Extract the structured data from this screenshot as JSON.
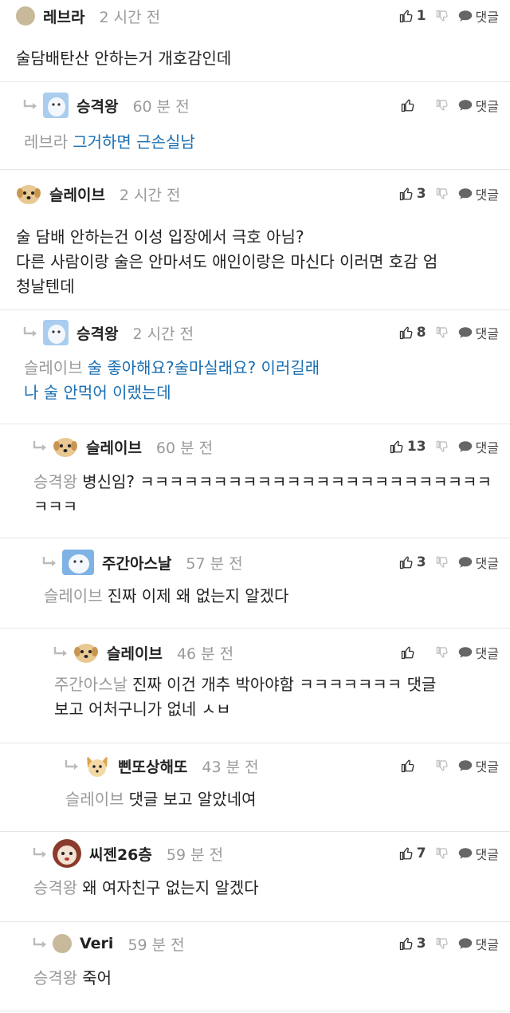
{
  "reply_label": "댓글",
  "comments": [
    {
      "author": "레브라",
      "time": "2 시간 전",
      "likes": "1",
      "mention": "",
      "text_lines": [
        "술담배탄산 안하는거 개호감인데"
      ]
    },
    {
      "author": "승격왕",
      "time": "60 분 전",
      "likes": "",
      "mention": "레브라",
      "text_lines": [
        "그거하면 근손실남"
      ]
    },
    {
      "author": "슬레이브",
      "time": "2 시간 전",
      "likes": "3",
      "mention": "",
      "text_lines": [
        "술 담배 안하는건 이성 입장에서 극호 아님?",
        "다른 사람이랑 술은 안마셔도 애인이랑은 마신다 이러면 호감 엄",
        "청날텐데"
      ]
    },
    {
      "author": "승격왕",
      "time": "2 시간 전",
      "likes": "8",
      "mention": "슬레이브",
      "text_lines": [
        "술 좋아해요?술마실래요? 이러길래",
        "나 술 안먹어 이랬는데"
      ]
    },
    {
      "author": "슬레이브",
      "time": "60 분 전",
      "likes": "13",
      "mention": "승격왕",
      "text_lines": [
        "병신임? ㅋㅋㅋㅋㅋㅋㅋㅋㅋㅋㅋㅋㅋㅋㅋㅋㅋㅋㅋㅋㅋㅋㅋㅋ",
        "ㅋㅋㅋ"
      ]
    },
    {
      "author": "주간아스날",
      "time": "57 분 전",
      "likes": "3",
      "mention": "슬레이브",
      "text_lines": [
        "진짜 이제 왜 없는지 알겠다"
      ]
    },
    {
      "author": "슬레이브",
      "time": "46 분 전",
      "likes": "",
      "mention": "주간아스날",
      "text_lines": [
        "진짜 이건 개추 박아야함 ㅋㅋㅋㅋㅋㅋㅋ 댓글",
        "보고 어처구니가 없네 ㅅㅂ"
      ]
    },
    {
      "author": "삔또상해또",
      "time": "43 분 전",
      "likes": "",
      "mention": "슬레이브",
      "text_lines": [
        "댓글 보고 알았네여"
      ]
    },
    {
      "author": "씨젠26층",
      "time": "59 분 전",
      "likes": "7",
      "mention": "승격왕",
      "text_lines": [
        "왜 여자친구 없는지 알겠다"
      ]
    },
    {
      "author": "Veri",
      "time": "59 분 전",
      "likes": "3",
      "mention": "승격왕",
      "text_lines": [
        "죽어"
      ]
    }
  ]
}
